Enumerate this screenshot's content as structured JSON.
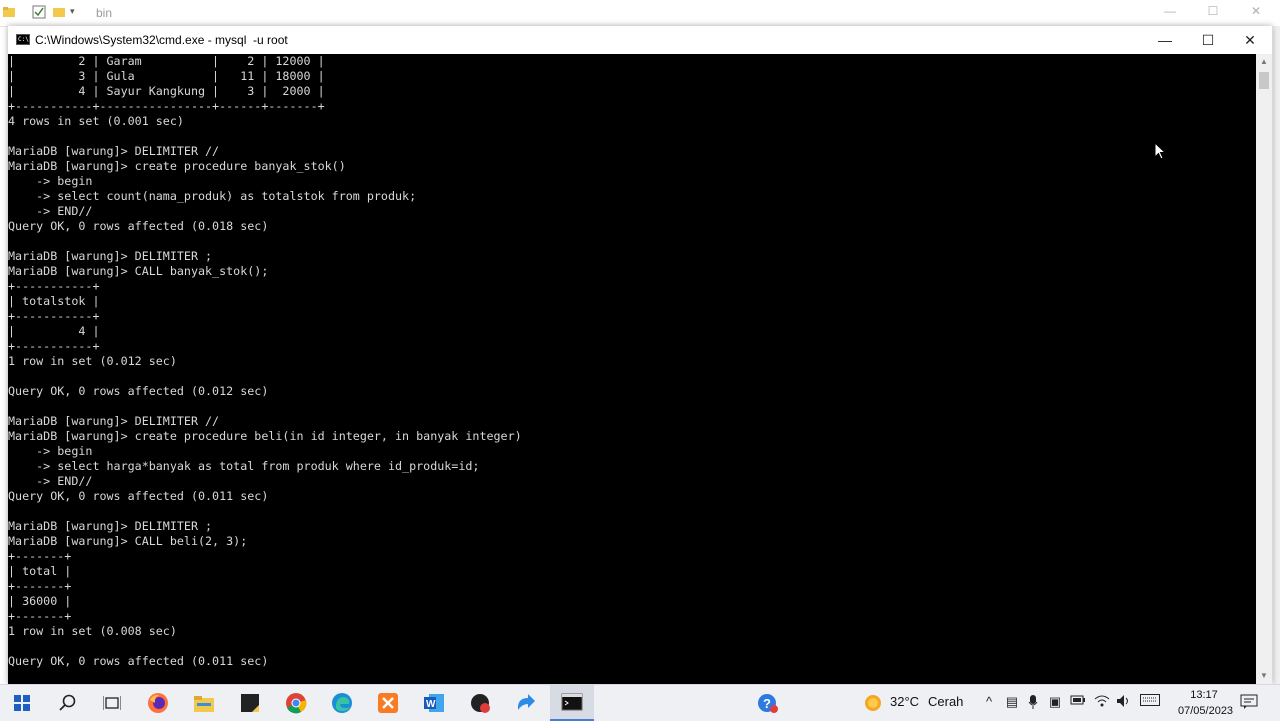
{
  "explorer": {
    "title": "bin",
    "controls": {
      "minimize": "—",
      "maximize": "☐",
      "close": "✕"
    }
  },
  "cmd": {
    "title": "C:\\Windows\\System32\\cmd.exe - mysql  -u root",
    "controls": {
      "minimize": "—",
      "maximize": "☐",
      "close": "✕"
    },
    "lines": [
      "|         2 | Garam          |    2 | 12000 |",
      "|         3 | Gula           |   11 | 18000 |",
      "|         4 | Sayur Kangkung |    3 |  2000 |",
      "+-----------+----------------+------+-------+",
      "4 rows in set (0.001 sec)",
      "",
      "MariaDB [warung]> DELIMITER //",
      "MariaDB [warung]> create procedure banyak_stok()",
      "    -> begin",
      "    -> select count(nama_produk) as totalstok from produk;",
      "    -> END//",
      "Query OK, 0 rows affected (0.018 sec)",
      "",
      "MariaDB [warung]> DELIMITER ;",
      "MariaDB [warung]> CALL banyak_stok();",
      "+-----------+",
      "| totalstok |",
      "+-----------+",
      "|         4 |",
      "+-----------+",
      "1 row in set (0.012 sec)",
      "",
      "Query OK, 0 rows affected (0.012 sec)",
      "",
      "MariaDB [warung]> DELIMITER //",
      "MariaDB [warung]> create procedure beli(in id integer, in banyak integer)",
      "    -> begin",
      "    -> select harga*banyak as total from produk where id_produk=id;",
      "    -> END//",
      "Query OK, 0 rows affected (0.011 sec)",
      "",
      "MariaDB [warung]> DELIMITER ;",
      "MariaDB [warung]> CALL beli(2, 3);",
      "+-------+",
      "| total |",
      "+-------+",
      "| 36000 |",
      "+-------+",
      "1 row in set (0.008 sec)",
      "",
      "Query OK, 0 rows affected (0.011 sec)"
    ]
  },
  "taskbar": {
    "weather_temp": "32°C",
    "weather_desc": "Cerah",
    "time": "13:17",
    "date": "07/05/2023"
  },
  "colors": {
    "console_bg": "#000000",
    "console_fg": "#d8d8d8",
    "taskbar_bg": "#eef0f4",
    "accent": "#4a7cd6"
  }
}
